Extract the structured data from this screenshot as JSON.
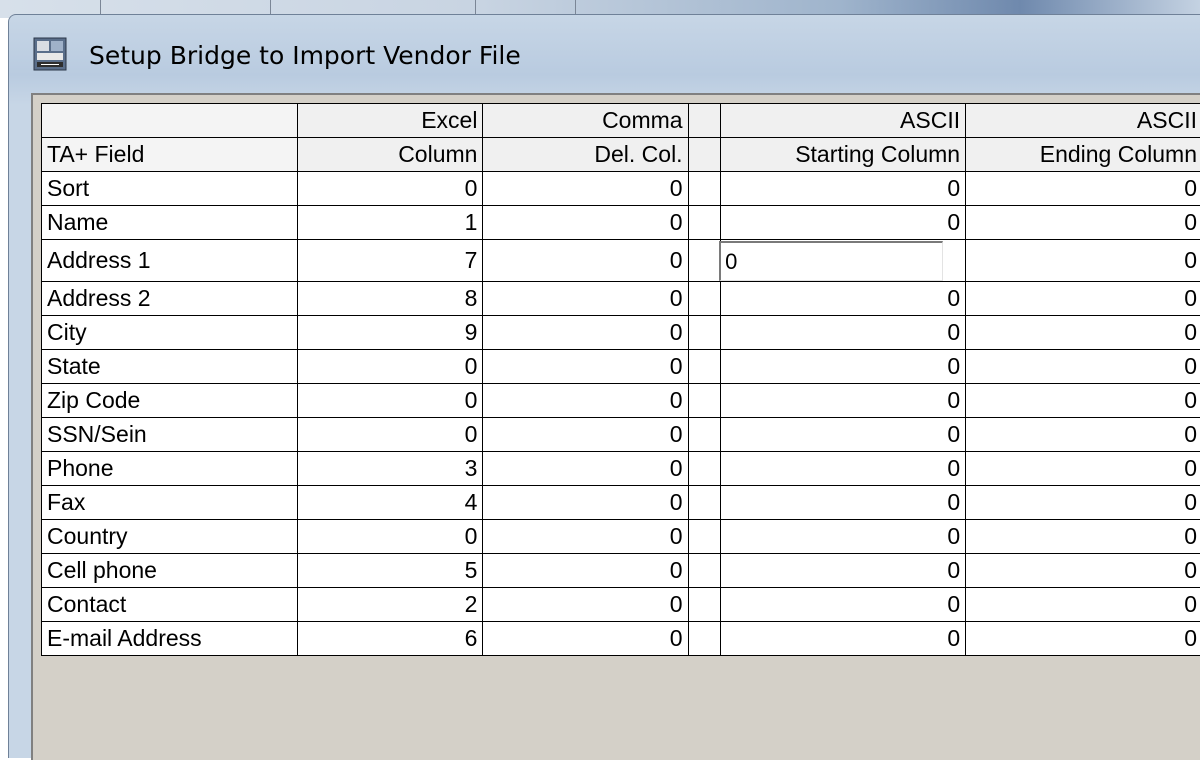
{
  "window": {
    "title": "Setup Bridge to Import Vendor File"
  },
  "table": {
    "header_row1": [
      "",
      "Excel",
      "Comma",
      "",
      "ASCII",
      "ASCII"
    ],
    "header_row2": [
      "TA+ Field",
      "Column",
      "Del. Col.",
      "",
      "Starting Column",
      "Ending Column"
    ],
    "rows": [
      {
        "field": "Sort",
        "excel": "0",
        "comma": "0",
        "ascii_start": "0",
        "ascii_end": "0"
      },
      {
        "field": "Name",
        "excel": "1",
        "comma": "0",
        "ascii_start": "0",
        "ascii_end": "0"
      },
      {
        "field": "Address 1",
        "excel": "7",
        "comma": "0",
        "ascii_start": "0",
        "ascii_end": "0"
      },
      {
        "field": "Address 2",
        "excel": "8",
        "comma": "0",
        "ascii_start": "0",
        "ascii_end": "0"
      },
      {
        "field": "City",
        "excel": "9",
        "comma": "0",
        "ascii_start": "0",
        "ascii_end": "0"
      },
      {
        "field": "State",
        "excel": "0",
        "comma": "0",
        "ascii_start": "0",
        "ascii_end": "0"
      },
      {
        "field": "Zip Code",
        "excel": "0",
        "comma": "0",
        "ascii_start": "0",
        "ascii_end": "0"
      },
      {
        "field": "SSN/Sein",
        "excel": "0",
        "comma": "0",
        "ascii_start": "0",
        "ascii_end": "0"
      },
      {
        "field": "Phone",
        "excel": "3",
        "comma": "0",
        "ascii_start": "0",
        "ascii_end": "0"
      },
      {
        "field": "Fax",
        "excel": "4",
        "comma": "0",
        "ascii_start": "0",
        "ascii_end": "0"
      },
      {
        "field": "Country",
        "excel": "0",
        "comma": "0",
        "ascii_start": "0",
        "ascii_end": "0"
      },
      {
        "field": "Cell phone",
        "excel": "5",
        "comma": "0",
        "ascii_start": "0",
        "ascii_end": "0"
      },
      {
        "field": "Contact",
        "excel": "2",
        "comma": "0",
        "ascii_start": "0",
        "ascii_end": "0"
      },
      {
        "field": "E-mail Address",
        "excel": "6",
        "comma": "0",
        "ascii_start": "0",
        "ascii_end": "0"
      }
    ],
    "active_edit": {
      "row": 2,
      "column": "ascii_start"
    }
  }
}
